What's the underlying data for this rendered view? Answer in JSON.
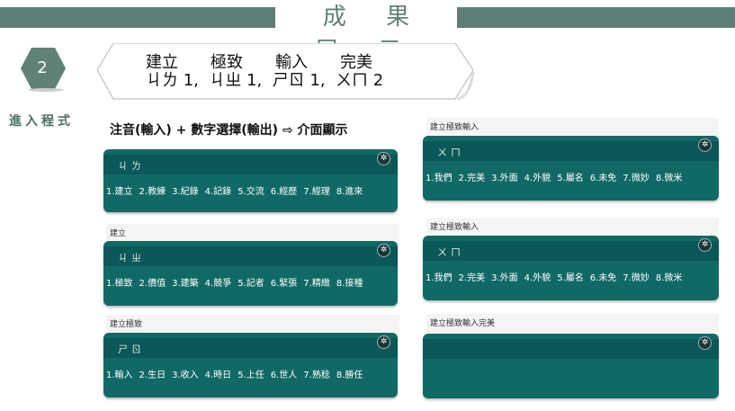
{
  "header": {
    "title": "成 果 展 示"
  },
  "step": {
    "number": "2",
    "label": "進入程式"
  },
  "callout": {
    "words": "建立　　極致　　輸入　　完美",
    "codes": "ㄐㄌ 1,  ㄐㄓ 1,  ㄕㄖ 1,  ㄨㄇ 2"
  },
  "heading": "注音(輸入) + 數字選擇(輸出) ⇨ 介面顯示",
  "icons": {
    "settings": "gear-icon"
  },
  "left_panels": [
    {
      "caption": "",
      "input": "ㄐㄌ",
      "candidates": [
        "1.建立",
        "2.教練",
        "3.紀錄",
        "4.記錄",
        "5.交流",
        "6.經歷",
        "7.經理",
        "8.進來"
      ]
    },
    {
      "caption": "建立",
      "input": "ㄐㄓ",
      "candidates": [
        "1.極致",
        "2.價值",
        "3.建築",
        "4.競爭",
        "5.記者",
        "6.緊張",
        "7.精緻",
        "8.接種"
      ]
    },
    {
      "caption": "建立極致",
      "input": "ㄕㄖ",
      "candidates": [
        "1.輸入",
        "2.生日",
        "3.收入",
        "4.時日",
        "5.上任",
        "6.世人",
        "7.熟稔",
        "8.勝任"
      ]
    }
  ],
  "right_panels": [
    {
      "caption": "建立極致輸入",
      "input": "ㄨㄇ",
      "candidates": [
        "1.我們",
        "2.完美",
        "3.外面",
        "4.外貌",
        "5.屬名",
        "6.未免",
        "7.微妙",
        "8.微米"
      ]
    },
    {
      "caption": "建立極致輸入",
      "input": "ㄨㄇ",
      "candidates": [
        "1.我們",
        "2.完美",
        "3.外面",
        "4.外貌",
        "5.屬名",
        "6.未免",
        "7.微妙",
        "8.微米"
      ]
    },
    {
      "caption": "建立極致輸入完美",
      "input": "",
      "candidates": []
    }
  ]
}
